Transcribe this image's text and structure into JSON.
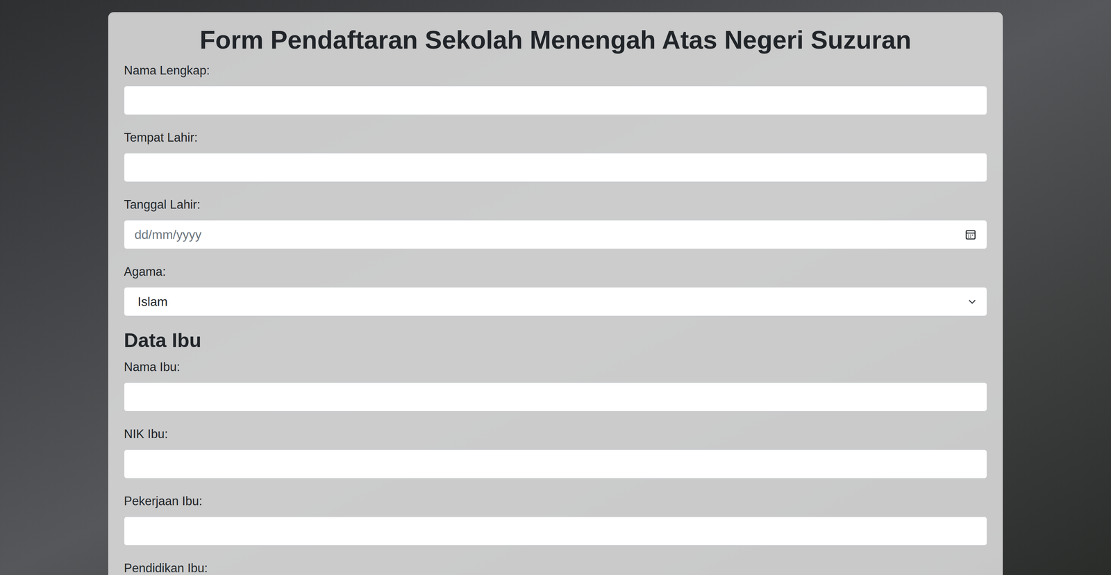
{
  "title": "Form Pendaftaran Sekolah Menengah Atas Negeri Suzuran",
  "fields": [
    {
      "label": "Nama Lengkap:",
      "kind": "text"
    },
    {
      "label": "Tempat Lahir:",
      "kind": "text"
    },
    {
      "label": "Tanggal Lahir:",
      "kind": "date",
      "placeholder": "dd/mm/yyyy"
    },
    {
      "label": "Agama:",
      "kind": "select",
      "value": "Islam"
    }
  ],
  "mother": {
    "heading": "Data Ibu",
    "fields": [
      {
        "label": "Nama Ibu:",
        "kind": "text"
      },
      {
        "label": "NIK Ibu:",
        "kind": "text"
      },
      {
        "label": "Pekerjaan Ibu:",
        "kind": "text"
      },
      {
        "label": "Pendidikan Ibu:",
        "kind": "text"
      }
    ]
  }
}
